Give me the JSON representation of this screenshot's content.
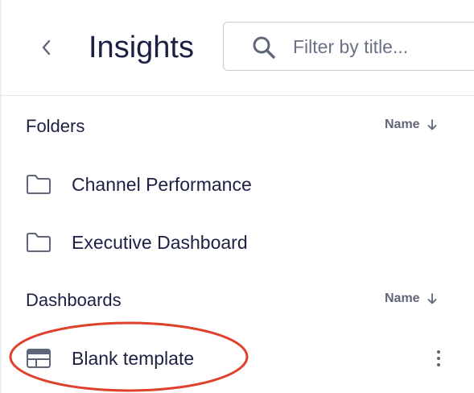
{
  "header": {
    "title": "Insights",
    "search": {
      "placeholder": "Filter by title...",
      "value": ""
    }
  },
  "folders": {
    "section_title": "Folders",
    "sort_label": "Name",
    "items": [
      {
        "label": "Channel Performance",
        "icon": "folder-icon"
      },
      {
        "label": "Executive Dashboard",
        "icon": "folder-icon"
      }
    ]
  },
  "dashboards": {
    "section_title": "Dashboards",
    "sort_label": "Name",
    "items": [
      {
        "label": "Blank template",
        "icon": "dashboard-icon",
        "highlighted": true
      }
    ]
  },
  "colors": {
    "text": "#1c2042",
    "muted": "#60667a",
    "border": "#c9ccd4",
    "annotation": "#e0412c"
  }
}
